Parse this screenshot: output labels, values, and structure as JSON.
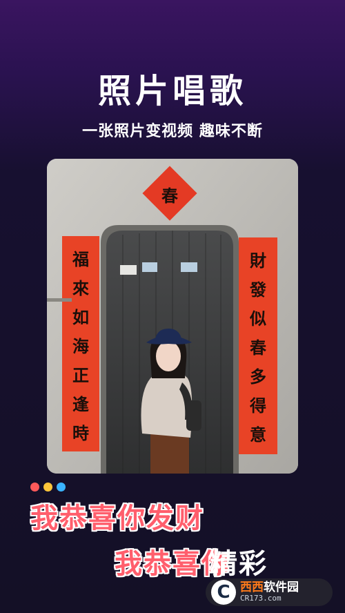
{
  "header": {
    "title": "照片唱歌",
    "subtitle": "一张照片变视频 趣味不断"
  },
  "photo": {
    "top_sign": "春",
    "left_couplet": [
      "福",
      "來",
      "如",
      "海",
      "正",
      "逢",
      "時"
    ],
    "right_couplet": [
      "財",
      "發",
      "似",
      "春",
      "多",
      "得",
      "意"
    ]
  },
  "dots": {
    "colors": [
      "#ff5a5a",
      "#ffc63a",
      "#3ab4ff"
    ]
  },
  "lyrics": {
    "line1": "我恭喜你发财",
    "line2": "我恭喜你",
    "tail": "精彩",
    "highlight_color": "#ff5e6c"
  },
  "watermark": {
    "logo": "C",
    "brand_orange": "西西",
    "brand_white": "软件园",
    "url": "CR173.com"
  }
}
